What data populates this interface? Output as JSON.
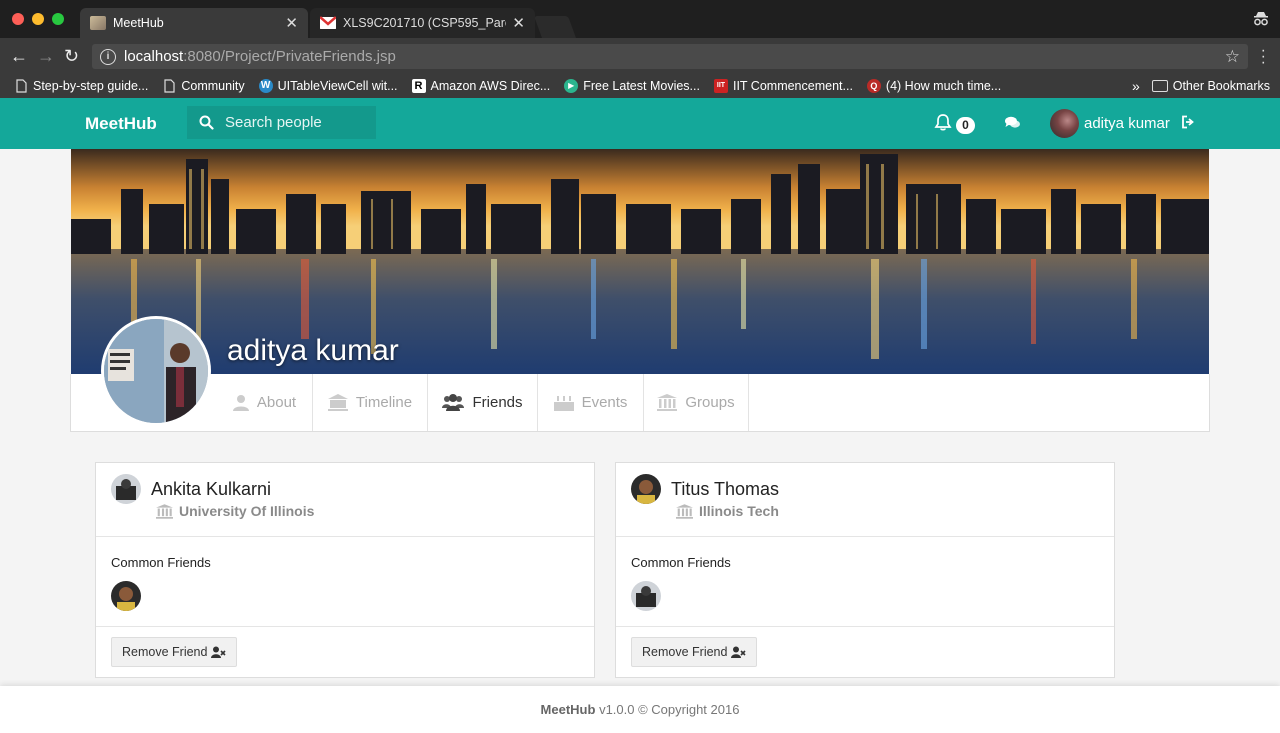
{
  "browser": {
    "tabs": [
      {
        "title": "MeetHub",
        "active": true
      },
      {
        "title": "XLS9C201710 (CSP595_Pare",
        "active": false
      }
    ],
    "url_host": "localhost",
    "url_path": ":8080/Project/PrivateFriends.jsp",
    "bookmarks": [
      {
        "label": "Step-by-step guide...",
        "icon": "page-icon"
      },
      {
        "label": "Community",
        "icon": "page-icon"
      },
      {
        "label": "UITableViewCell wit...",
        "icon": "wordpress-icon"
      },
      {
        "label": "Amazon AWS Direc...",
        "icon": "r-icon"
      },
      {
        "label": "Free Latest Movies...",
        "icon": "play-icon"
      },
      {
        "label": "IIT Commencement...",
        "icon": "iit-icon"
      },
      {
        "label": "(4) How much time...",
        "icon": "quora-icon"
      }
    ],
    "other_bookmarks": "Other Bookmarks"
  },
  "nav": {
    "brand": "MeetHub",
    "search_placeholder": "Search people",
    "notification_count": "0",
    "username": "aditya kumar"
  },
  "profile": {
    "name": "aditya kumar",
    "tabs": [
      {
        "label": "About",
        "icon": "user-icon",
        "active": false
      },
      {
        "label": "Timeline",
        "icon": "timeline-icon",
        "active": false
      },
      {
        "label": "Friends",
        "icon": "users-icon",
        "active": true
      },
      {
        "label": "Events",
        "icon": "cake-icon",
        "active": false
      },
      {
        "label": "Groups",
        "icon": "institution-icon",
        "active": false
      }
    ]
  },
  "friends": [
    {
      "name": "Ankita Kulkarni",
      "school": "University Of Illinois",
      "common_label": "Common Friends",
      "remove_label": "Remove Friend"
    },
    {
      "name": "Titus Thomas",
      "school": "Illinois Tech",
      "common_label": "Common Friends",
      "remove_label": "Remove Friend"
    }
  ],
  "footer": {
    "brand": "MeetHub",
    "text": "v1.0.0 © Copyright 2016"
  },
  "colors": {
    "accent": "#14a89a",
    "search_bg": "#13998c"
  }
}
